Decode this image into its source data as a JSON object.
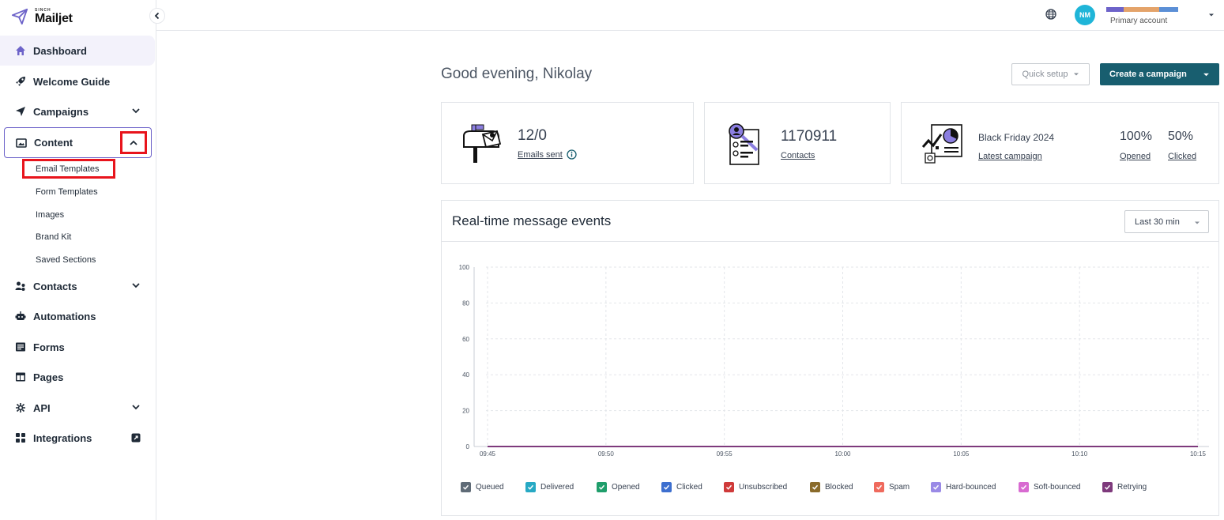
{
  "brand": {
    "small": "SINCH",
    "name": "Mailjet"
  },
  "sidebar": {
    "items": [
      {
        "label": "Dashboard"
      },
      {
        "label": "Welcome Guide"
      },
      {
        "label": "Campaigns"
      },
      {
        "label": "Content"
      },
      {
        "label": "Contacts"
      },
      {
        "label": "Automations"
      },
      {
        "label": "Forms"
      },
      {
        "label": "Pages"
      },
      {
        "label": "API"
      },
      {
        "label": "Integrations"
      }
    ],
    "content_sub": [
      "Email Templates",
      "Form Templates",
      "Images",
      "Brand Kit",
      "Saved Sections"
    ]
  },
  "topbar": {
    "avatar": "NM",
    "account_label": "Primary account",
    "account_colors": [
      "#6d63c9",
      "#e4a36a",
      "#5b8fd6"
    ]
  },
  "main": {
    "greeting": "Good evening, Nikolay",
    "quick_setup": "Quick setup",
    "create_campaign": "Create a campaign"
  },
  "cards": {
    "emails": {
      "value": "12/0",
      "link": "Emails sent"
    },
    "contacts": {
      "value": "1170911",
      "link": "Contacts"
    },
    "campaign": {
      "name": "Black Friday 2024",
      "link": "Latest campaign",
      "opened_value": "100%",
      "opened_label": "Opened",
      "clicked_value": "50%",
      "clicked_label": "Clicked"
    }
  },
  "events": {
    "title": "Real-time message events",
    "range": "Last 30 min"
  },
  "chart_data": {
    "type": "line",
    "title": "Real-time message events",
    "x": [
      "09:45",
      "09:50",
      "09:55",
      "10:00",
      "10:05",
      "10:10",
      "10:15"
    ],
    "y_ticks": [
      0,
      20,
      40,
      60,
      80,
      100
    ],
    "ylim": [
      0,
      100
    ],
    "grid": true,
    "legend_position": "bottom",
    "series": [
      {
        "name": "Queued",
        "color": "#5f6b77",
        "values": [
          0,
          0,
          0,
          0,
          0,
          0,
          0
        ]
      },
      {
        "name": "Delivered",
        "color": "#27a9c4",
        "values": [
          0,
          0,
          0,
          0,
          0,
          0,
          0
        ]
      },
      {
        "name": "Opened",
        "color": "#1f9e6b",
        "values": [
          0,
          0,
          0,
          0,
          0,
          0,
          0
        ]
      },
      {
        "name": "Clicked",
        "color": "#3d6fcf",
        "values": [
          0,
          0,
          0,
          0,
          0,
          0,
          0
        ]
      },
      {
        "name": "Unsubscribed",
        "color": "#cf3a3a",
        "values": [
          0,
          0,
          0,
          0,
          0,
          0,
          0
        ]
      },
      {
        "name": "Blocked",
        "color": "#8a6b2b",
        "values": [
          0,
          0,
          0,
          0,
          0,
          0,
          0
        ]
      },
      {
        "name": "Spam",
        "color": "#ef6a5d",
        "values": [
          0,
          0,
          0,
          0,
          0,
          0,
          0
        ]
      },
      {
        "name": "Hard-bounced",
        "color": "#9a8ae6",
        "values": [
          0,
          0,
          0,
          0,
          0,
          0,
          0
        ]
      },
      {
        "name": "Soft-bounced",
        "color": "#d86bd1",
        "values": [
          0,
          0,
          0,
          0,
          0,
          0,
          0
        ]
      },
      {
        "name": "Retrying",
        "color": "#7e3a7c",
        "values": [
          0,
          0,
          0,
          0,
          0,
          0,
          0
        ]
      }
    ]
  }
}
